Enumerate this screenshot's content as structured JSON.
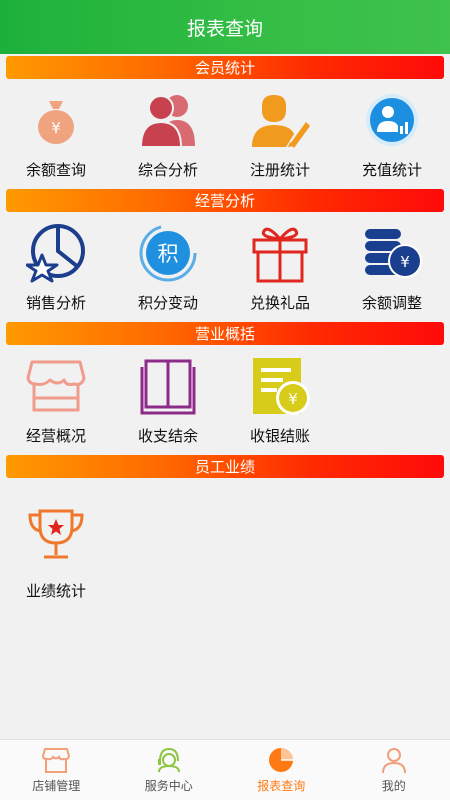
{
  "header": {
    "title": "报表查询"
  },
  "sections": [
    {
      "title": "会员统计",
      "items": [
        {
          "label": "余额查询",
          "icon": "money-bag-icon"
        },
        {
          "label": "综合分析",
          "icon": "users-icon"
        },
        {
          "label": "注册统计",
          "icon": "user-edit-icon"
        },
        {
          "label": "充值统计",
          "icon": "user-stats-icon"
        }
      ]
    },
    {
      "title": "经营分析",
      "items": [
        {
          "label": "销售分析",
          "icon": "pie-star-icon"
        },
        {
          "label": "积分变动",
          "icon": "points-icon",
          "glyph": "积"
        },
        {
          "label": "兑换礼品",
          "icon": "gift-icon"
        },
        {
          "label": "余额调整",
          "icon": "coins-icon",
          "glyph": "¥"
        }
      ]
    },
    {
      "title": "营业概括",
      "items": [
        {
          "label": "经营概况",
          "icon": "shop-icon"
        },
        {
          "label": "收支结余",
          "icon": "book-icon"
        },
        {
          "label": "收银结账",
          "icon": "cash-doc-icon",
          "glyph": "¥"
        }
      ]
    },
    {
      "title": "员工业绩",
      "items": [
        {
          "label": "业绩统计",
          "icon": "trophy-icon"
        }
      ]
    }
  ],
  "tabbar": [
    {
      "label": "店铺管理",
      "icon": "store-icon",
      "active": false
    },
    {
      "label": "服务中心",
      "icon": "service-icon",
      "active": false
    },
    {
      "label": "报表查询",
      "icon": "report-icon",
      "active": true
    },
    {
      "label": "我的",
      "icon": "profile-icon",
      "active": false
    }
  ],
  "colors": {
    "accent": "#ff7a14",
    "header": "#33bd45",
    "section_start": "#ff9a00",
    "section_end": "#ff0a0a"
  }
}
